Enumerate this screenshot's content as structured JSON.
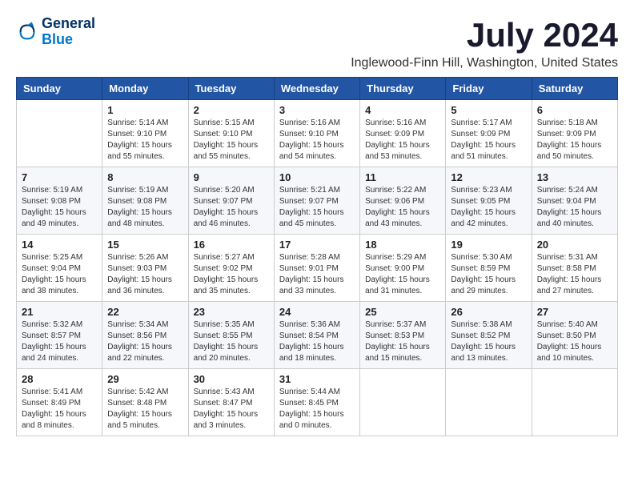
{
  "logo": {
    "line1": "General",
    "line2": "Blue"
  },
  "title": "July 2024",
  "subtitle": "Inglewood-Finn Hill, Washington, United States",
  "weekdays": [
    "Sunday",
    "Monday",
    "Tuesday",
    "Wednesday",
    "Thursday",
    "Friday",
    "Saturday"
  ],
  "weeks": [
    [
      {
        "day": "",
        "info": ""
      },
      {
        "day": "1",
        "info": "Sunrise: 5:14 AM\nSunset: 9:10 PM\nDaylight: 15 hours\nand 55 minutes."
      },
      {
        "day": "2",
        "info": "Sunrise: 5:15 AM\nSunset: 9:10 PM\nDaylight: 15 hours\nand 55 minutes."
      },
      {
        "day": "3",
        "info": "Sunrise: 5:16 AM\nSunset: 9:10 PM\nDaylight: 15 hours\nand 54 minutes."
      },
      {
        "day": "4",
        "info": "Sunrise: 5:16 AM\nSunset: 9:09 PM\nDaylight: 15 hours\nand 53 minutes."
      },
      {
        "day": "5",
        "info": "Sunrise: 5:17 AM\nSunset: 9:09 PM\nDaylight: 15 hours\nand 51 minutes."
      },
      {
        "day": "6",
        "info": "Sunrise: 5:18 AM\nSunset: 9:09 PM\nDaylight: 15 hours\nand 50 minutes."
      }
    ],
    [
      {
        "day": "7",
        "info": "Sunrise: 5:19 AM\nSunset: 9:08 PM\nDaylight: 15 hours\nand 49 minutes."
      },
      {
        "day": "8",
        "info": "Sunrise: 5:19 AM\nSunset: 9:08 PM\nDaylight: 15 hours\nand 48 minutes."
      },
      {
        "day": "9",
        "info": "Sunrise: 5:20 AM\nSunset: 9:07 PM\nDaylight: 15 hours\nand 46 minutes."
      },
      {
        "day": "10",
        "info": "Sunrise: 5:21 AM\nSunset: 9:07 PM\nDaylight: 15 hours\nand 45 minutes."
      },
      {
        "day": "11",
        "info": "Sunrise: 5:22 AM\nSunset: 9:06 PM\nDaylight: 15 hours\nand 43 minutes."
      },
      {
        "day": "12",
        "info": "Sunrise: 5:23 AM\nSunset: 9:05 PM\nDaylight: 15 hours\nand 42 minutes."
      },
      {
        "day": "13",
        "info": "Sunrise: 5:24 AM\nSunset: 9:04 PM\nDaylight: 15 hours\nand 40 minutes."
      }
    ],
    [
      {
        "day": "14",
        "info": "Sunrise: 5:25 AM\nSunset: 9:04 PM\nDaylight: 15 hours\nand 38 minutes."
      },
      {
        "day": "15",
        "info": "Sunrise: 5:26 AM\nSunset: 9:03 PM\nDaylight: 15 hours\nand 36 minutes."
      },
      {
        "day": "16",
        "info": "Sunrise: 5:27 AM\nSunset: 9:02 PM\nDaylight: 15 hours\nand 35 minutes."
      },
      {
        "day": "17",
        "info": "Sunrise: 5:28 AM\nSunset: 9:01 PM\nDaylight: 15 hours\nand 33 minutes."
      },
      {
        "day": "18",
        "info": "Sunrise: 5:29 AM\nSunset: 9:00 PM\nDaylight: 15 hours\nand 31 minutes."
      },
      {
        "day": "19",
        "info": "Sunrise: 5:30 AM\nSunset: 8:59 PM\nDaylight: 15 hours\nand 29 minutes."
      },
      {
        "day": "20",
        "info": "Sunrise: 5:31 AM\nSunset: 8:58 PM\nDaylight: 15 hours\nand 27 minutes."
      }
    ],
    [
      {
        "day": "21",
        "info": "Sunrise: 5:32 AM\nSunset: 8:57 PM\nDaylight: 15 hours\nand 24 minutes."
      },
      {
        "day": "22",
        "info": "Sunrise: 5:34 AM\nSunset: 8:56 PM\nDaylight: 15 hours\nand 22 minutes."
      },
      {
        "day": "23",
        "info": "Sunrise: 5:35 AM\nSunset: 8:55 PM\nDaylight: 15 hours\nand 20 minutes."
      },
      {
        "day": "24",
        "info": "Sunrise: 5:36 AM\nSunset: 8:54 PM\nDaylight: 15 hours\nand 18 minutes."
      },
      {
        "day": "25",
        "info": "Sunrise: 5:37 AM\nSunset: 8:53 PM\nDaylight: 15 hours\nand 15 minutes."
      },
      {
        "day": "26",
        "info": "Sunrise: 5:38 AM\nSunset: 8:52 PM\nDaylight: 15 hours\nand 13 minutes."
      },
      {
        "day": "27",
        "info": "Sunrise: 5:40 AM\nSunset: 8:50 PM\nDaylight: 15 hours\nand 10 minutes."
      }
    ],
    [
      {
        "day": "28",
        "info": "Sunrise: 5:41 AM\nSunset: 8:49 PM\nDaylight: 15 hours\nand 8 minutes."
      },
      {
        "day": "29",
        "info": "Sunrise: 5:42 AM\nSunset: 8:48 PM\nDaylight: 15 hours\nand 5 minutes."
      },
      {
        "day": "30",
        "info": "Sunrise: 5:43 AM\nSunset: 8:47 PM\nDaylight: 15 hours\nand 3 minutes."
      },
      {
        "day": "31",
        "info": "Sunrise: 5:44 AM\nSunset: 8:45 PM\nDaylight: 15 hours\nand 0 minutes."
      },
      {
        "day": "",
        "info": ""
      },
      {
        "day": "",
        "info": ""
      },
      {
        "day": "",
        "info": ""
      }
    ]
  ]
}
